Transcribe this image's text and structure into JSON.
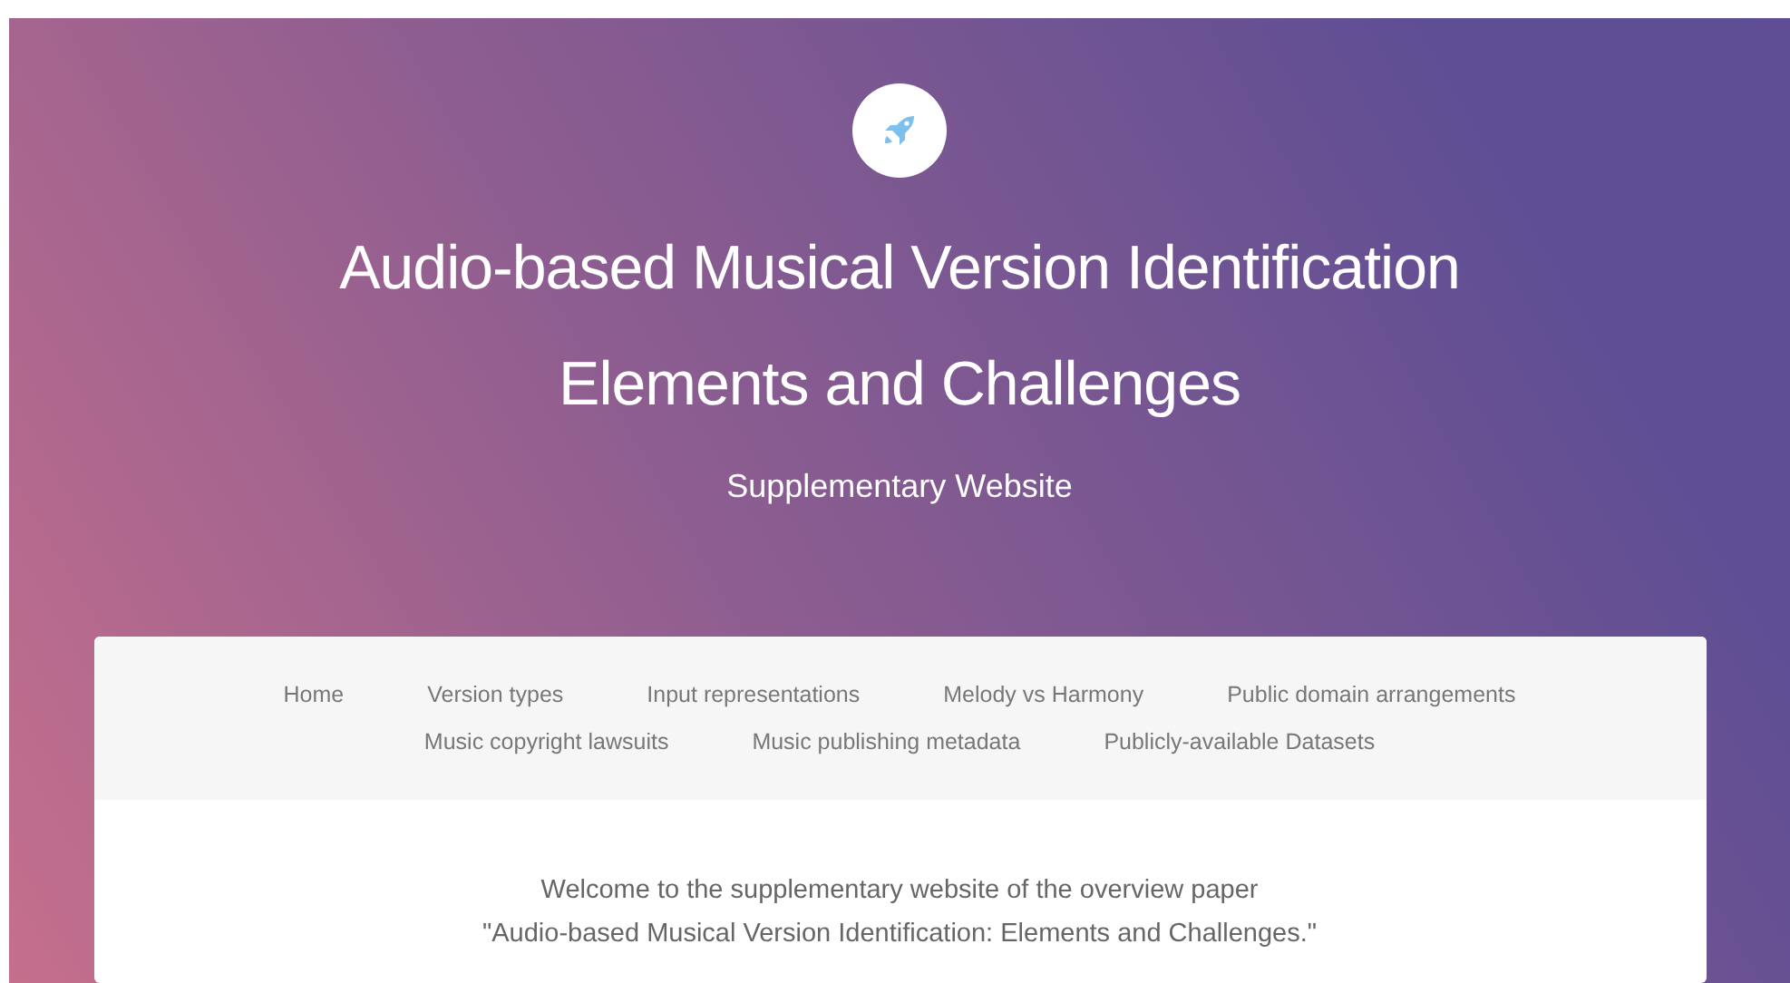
{
  "header": {
    "title_lines": [
      "Audio-based Musical Version Identification",
      "Elements and Challenges"
    ],
    "subtitle": "Supplementary Website"
  },
  "nav": {
    "links": [
      "Home",
      "Version types",
      "Input representations",
      "Melody vs Harmony",
      "Public domain arrangements",
      "Music copyright lawsuits",
      "Music publishing metadata",
      "Publicly-available Datasets"
    ]
  },
  "intro": [
    "Welcome to the supplementary website of the overview paper",
    "\"Audio-based Musical Version Identification: Elements and Challenges.\""
  ]
}
